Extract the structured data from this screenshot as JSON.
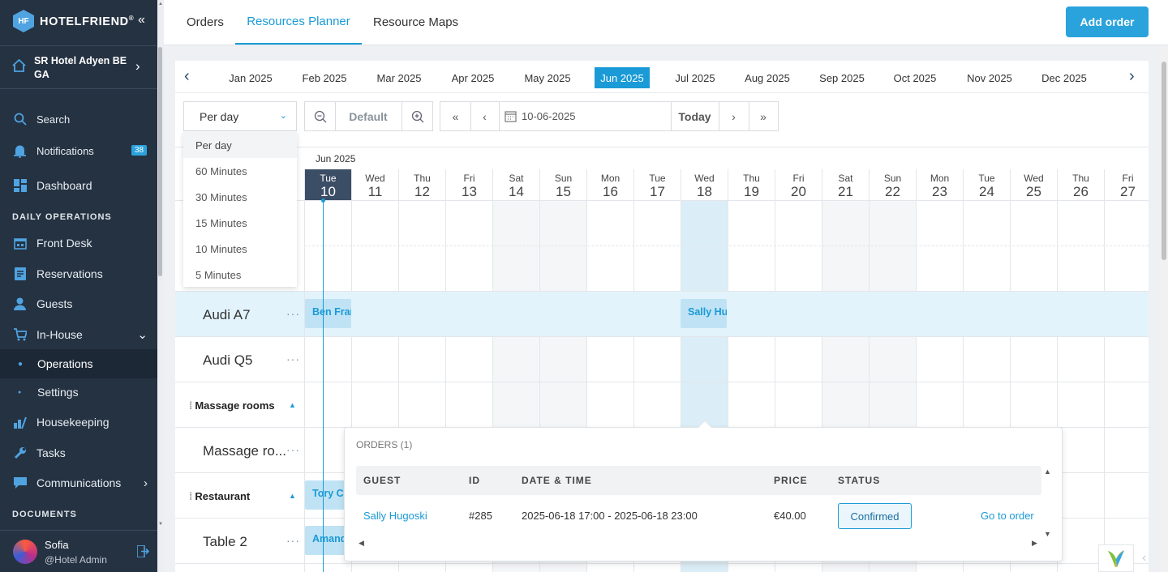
{
  "brand": {
    "name": "HOTELFRIEND",
    "trademark": "®",
    "logo_letters": "HF"
  },
  "sidebar": {
    "hotel_name": "SR Hotel Adyen BE GA",
    "search": "Search",
    "notifications": "Notifications",
    "notifications_count": "38",
    "dashboard": "Dashboard",
    "section_daily": "DAILY OPERATIONS",
    "front_desk": "Front Desk",
    "reservations": "Reservations",
    "guests": "Guests",
    "in_house": "In-House",
    "operations": "Operations",
    "settings": "Settings",
    "housekeeping": "Housekeeping",
    "tasks": "Tasks",
    "communications": "Communications",
    "section_documents": "DOCUMENTS",
    "user_name": "Sofia",
    "user_role": "@Hotel Admin"
  },
  "topbar": {
    "tabs": [
      "Orders",
      "Resources Planner",
      "Resource Maps"
    ],
    "active_tab": "Resources Planner",
    "add_order": "Add order"
  },
  "months": [
    "Jan 2025",
    "Feb 2025",
    "Mar 2025",
    "Apr 2025",
    "May 2025",
    "Jun 2025",
    "Jul 2025",
    "Aug 2025",
    "Sep 2025",
    "Oct 2025",
    "Nov 2025",
    "Dec 2025"
  ],
  "selected_month": "Jun 2025",
  "controls": {
    "view_select": "Per day",
    "zoom_default": "Default",
    "date_value": "10-06-2025",
    "today": "Today"
  },
  "view_options": [
    "Per day",
    "60 Minutes",
    "30 Minutes",
    "15 Minutes",
    "10 Minutes",
    "5 Minutes"
  ],
  "grid": {
    "month_label": "Jun 2025",
    "days": [
      {
        "name": "Tue",
        "num": "10"
      },
      {
        "name": "Wed",
        "num": "11"
      },
      {
        "name": "Thu",
        "num": "12"
      },
      {
        "name": "Fri",
        "num": "13"
      },
      {
        "name": "Sat",
        "num": "14"
      },
      {
        "name": "Sun",
        "num": "15"
      },
      {
        "name": "Mon",
        "num": "16"
      },
      {
        "name": "Tue",
        "num": "17"
      },
      {
        "name": "Wed",
        "num": "18"
      },
      {
        "name": "Thu",
        "num": "19"
      },
      {
        "name": "Fri",
        "num": "20"
      },
      {
        "name": "Sat",
        "num": "21"
      },
      {
        "name": "Sun",
        "num": "22"
      },
      {
        "name": "Mon",
        "num": "23"
      },
      {
        "name": "Tue",
        "num": "24"
      },
      {
        "name": "Wed",
        "num": "25"
      },
      {
        "name": "Thu",
        "num": "26"
      },
      {
        "name": "Fri",
        "num": "27"
      }
    ],
    "today_index": 0,
    "highlight_index": 8,
    "rows": {
      "audi_a7": "Audi A7",
      "audi_q5": "Audi Q5",
      "massage_group": "Massage rooms",
      "massage_room": "Massage ro...",
      "restaurant_group": "Restaurant",
      "table2": "Table 2"
    },
    "bookings": {
      "ben": "Ben Franklin",
      "sally": "Sally Hugoski",
      "tory": "Tory Chase",
      "amanda": "Amanda"
    }
  },
  "popup": {
    "title": "ORDERS (1)",
    "headers": [
      "GUEST",
      "ID",
      "DATE & TIME",
      "PRICE",
      "STATUS"
    ],
    "row": {
      "guest": "Sally Hugoski",
      "id": "#285",
      "datetime": "2025-06-18 17:00 - 2025-06-18 23:00",
      "price": "€40.00",
      "status": "Confirmed",
      "action": "Go to order"
    }
  },
  "colors": {
    "accent": "#1a9ad6",
    "sidebar": "#253242",
    "today": "#3c4d66"
  }
}
